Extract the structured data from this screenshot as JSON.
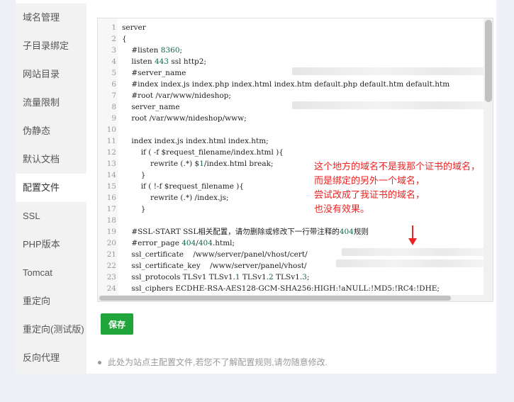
{
  "sidebar": {
    "items": [
      {
        "label": "域名管理"
      },
      {
        "label": "子目录绑定"
      },
      {
        "label": "网站目录"
      },
      {
        "label": "流量限制"
      },
      {
        "label": "伪静态"
      },
      {
        "label": "默认文档"
      },
      {
        "label": "配置文件"
      },
      {
        "label": "SSL"
      },
      {
        "label": "PHP版本"
      },
      {
        "label": "Tomcat"
      },
      {
        "label": "重定向"
      },
      {
        "label": "重定向(测试版)"
      },
      {
        "label": "反向代理"
      }
    ],
    "active": "配置文件"
  },
  "editor": {
    "lines": [
      {
        "n": "1",
        "code": "server"
      },
      {
        "n": "2",
        "code": "{"
      },
      {
        "n": "3",
        "code": "    #listen 8360;"
      },
      {
        "n": "4",
        "code": "    listen 443 ssl http2;"
      },
      {
        "n": "5",
        "code": "    #server_name"
      },
      {
        "n": "6",
        "code": "    #index index.js index.php index.html index.htm default.php default.htm default.htm"
      },
      {
        "n": "7",
        "code": "    #root /var/www/nideshop;"
      },
      {
        "n": "8",
        "code": "    server_name"
      },
      {
        "n": "9",
        "code": "    root /var/www/nideshop/www;"
      },
      {
        "n": "10",
        "code": ""
      },
      {
        "n": "11",
        "code": "    index index.js index.html index.htm;"
      },
      {
        "n": "12",
        "code": "        if ( -f $request_filename/index.html ){"
      },
      {
        "n": "13",
        "code": "            rewrite (.*) $1/index.html break;"
      },
      {
        "n": "14",
        "code": "        }"
      },
      {
        "n": "15",
        "code": "        if ( !-f $request_filename ){"
      },
      {
        "n": "16",
        "code": "            rewrite (.*) /index.js;"
      },
      {
        "n": "17",
        "code": "        }"
      },
      {
        "n": "18",
        "code": ""
      },
      {
        "n": "19",
        "code": "    #SSL-START SSL相关配置，请勿删除或修改下一行带注释的404规则"
      },
      {
        "n": "20",
        "code": "    #error_page 404/404.html;"
      },
      {
        "n": "21",
        "code": "    ssl_certificate    /www/server/panel/vhost/cert/"
      },
      {
        "n": "22",
        "code": "    ssl_certificate_key    /www/server/panel/vhost/"
      },
      {
        "n": "23",
        "code": "    ssl_protocols TLSv1 TLSv1.1 TLSv1.2 TLSv1.3;"
      },
      {
        "n": "24",
        "code": "    ssl_ciphers ECDHE-RSA-AES128-GCM-SHA256:HIGH:!aNULL:!MD5:!RC4:!DHE;"
      }
    ]
  },
  "annotation": "这个地方的域名不是我那个证书的域名，\n而是绑定的另外一个域名，\n尝试改成了我证书的域名，\n也没有效果。",
  "save_label": "保存",
  "note": "此处为站点主配置文件,若您不了解配置规则,请勿随意修改.",
  "colors": {
    "save": "#20a53a",
    "annotation": "#ee2222",
    "number": "#116644"
  }
}
